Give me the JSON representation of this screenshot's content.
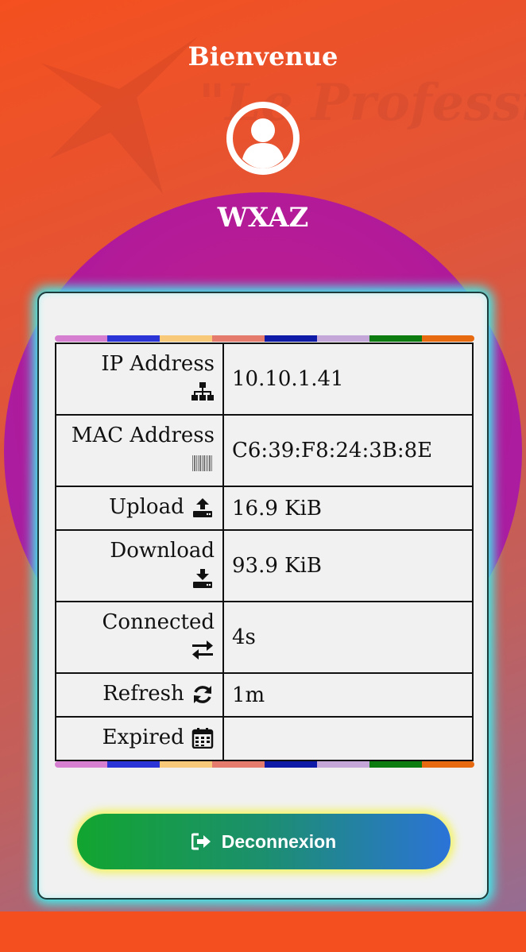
{
  "header": {
    "title": "Bienvenue",
    "username": "WXAZ"
  },
  "info": {
    "rows": [
      {
        "label": "IP Address",
        "icon": "network-icon",
        "value": "10.10.1.41"
      },
      {
        "label": "MAC Address",
        "icon": "barcode-icon",
        "value": "C6:39:F8:24:3B:8E"
      },
      {
        "label": "Upload",
        "icon": "upload-icon",
        "value": "16.9 KiB"
      },
      {
        "label": "Download",
        "icon": "download-icon",
        "value": "93.9 KiB"
      },
      {
        "label": "Connected",
        "icon": "exchange-icon",
        "value": "4s"
      },
      {
        "label": "Refresh",
        "icon": "refresh-icon",
        "value": "1m"
      },
      {
        "label": "Expired",
        "icon": "calendar-icon",
        "value": ""
      }
    ]
  },
  "logout": {
    "label": "Deconnexion",
    "icon": "sign-out-icon"
  },
  "colors": {
    "stripe": [
      "#d67fd0",
      "#2b34d6",
      "#f7c978",
      "#e47b6c",
      "#0f1aa6",
      "#c4a7d8",
      "#0c7b10",
      "#e86a10"
    ],
    "card_glow": "#3ff0f0",
    "button_glow": "#f3f46a",
    "circle": "#b01a9a",
    "background": "#f4501f"
  }
}
